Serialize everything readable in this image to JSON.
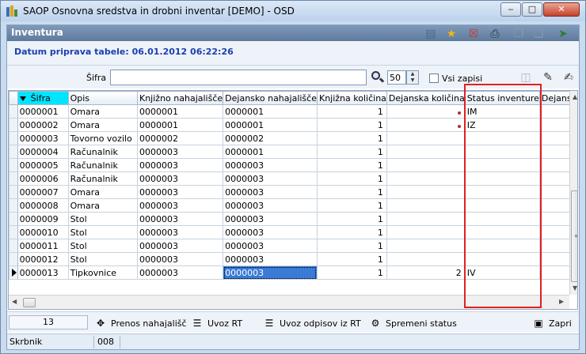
{
  "window": {
    "title": "SAOP  Osnovna sredstva in drobni inventar [DEMO] - OSD",
    "minimize": "‒",
    "maximize": "□",
    "close": "✕"
  },
  "panel": {
    "title": "Inventura",
    "datum": "Datum priprava tabele: 06.01.2012 06:22:26"
  },
  "toolbar_icons": [
    "report-icon",
    "star-icon",
    "delete-icon",
    "print-icon",
    "copy-icon",
    "paste-icon",
    "export-icon"
  ],
  "filter": {
    "label": "Šifra",
    "value": "",
    "count": "50",
    "all_records_label": "Vsi zapisi"
  },
  "grid": {
    "columns": [
      "Šifra",
      "Opis",
      "Knjižno nahajališče",
      "Dejansko nahajališče",
      "Knjižna količina",
      "Dejanska količina",
      "Status inventure",
      "Dejansk"
    ],
    "rows": [
      {
        "sifra": "0000001",
        "opis": "Omara",
        "knjizno": "0000001",
        "dejansko": "0000001",
        "kol": "1",
        "dejkol": "",
        "status": "IM",
        "dot": true,
        "current": false
      },
      {
        "sifra": "0000002",
        "opis": "Omara",
        "knjizno": "0000001",
        "dejansko": "0000001",
        "kol": "1",
        "dejkol": "",
        "status": "IZ",
        "dot": true,
        "current": false
      },
      {
        "sifra": "0000003",
        "opis": "Tovorno vozilo",
        "knjizno": "0000002",
        "dejansko": "0000002",
        "kol": "1",
        "dejkol": "",
        "status": "",
        "dot": false,
        "current": false
      },
      {
        "sifra": "0000004",
        "opis": "Računalnik",
        "knjizno": "0000003",
        "dejansko": "0000001",
        "kol": "1",
        "dejkol": "",
        "status": "",
        "dot": false,
        "current": false
      },
      {
        "sifra": "0000005",
        "opis": "Računalnik",
        "knjizno": "0000003",
        "dejansko": "0000003",
        "kol": "1",
        "dejkol": "",
        "status": "",
        "dot": false,
        "current": false
      },
      {
        "sifra": "0000006",
        "opis": "Računalnik",
        "knjizno": "0000003",
        "dejansko": "0000003",
        "kol": "1",
        "dejkol": "",
        "status": "",
        "dot": false,
        "current": false
      },
      {
        "sifra": "0000007",
        "opis": "Omara",
        "knjizno": "0000003",
        "dejansko": "0000003",
        "kol": "1",
        "dejkol": "",
        "status": "",
        "dot": false,
        "current": false
      },
      {
        "sifra": "0000008",
        "opis": "Omara",
        "knjizno": "0000003",
        "dejansko": "0000003",
        "kol": "1",
        "dejkol": "",
        "status": "",
        "dot": false,
        "current": false
      },
      {
        "sifra": "0000009",
        "opis": "Stol",
        "knjizno": "0000003",
        "dejansko": "0000003",
        "kol": "1",
        "dejkol": "",
        "status": "",
        "dot": false,
        "current": false
      },
      {
        "sifra": "0000010",
        "opis": "Stol",
        "knjizno": "0000003",
        "dejansko": "0000003",
        "kol": "1",
        "dejkol": "",
        "status": "",
        "dot": false,
        "current": false
      },
      {
        "sifra": "0000011",
        "opis": "Stol",
        "knjizno": "0000003",
        "dejansko": "0000003",
        "kol": "1",
        "dejkol": "",
        "status": "",
        "dot": false,
        "current": false
      },
      {
        "sifra": "0000012",
        "opis": "Stol",
        "knjizno": "0000003",
        "dejansko": "0000003",
        "kol": "1",
        "dejkol": "",
        "status": "",
        "dot": false,
        "current": false
      },
      {
        "sifra": "0000013",
        "opis": "Tipkovnice",
        "knjizno": "0000003",
        "dejansko": "0000003",
        "kol": "1",
        "dejkol": "2",
        "status": "IV",
        "dot": false,
        "current": true
      }
    ]
  },
  "bottom": {
    "record_count": "13",
    "buttons": [
      "Prenos nahajališč",
      "Uvoz RT",
      "Uvoz odpisov iz RT",
      "Spremeni status",
      "Zapri"
    ]
  },
  "status_bar": {
    "user": "Skrbnik",
    "code": "008"
  },
  "colors": {
    "sorted_header": "#00e5ff",
    "highlight_box": "#e02020",
    "selected_cell": "#3b7bd6",
    "datum_text": "#1a3fb0"
  }
}
